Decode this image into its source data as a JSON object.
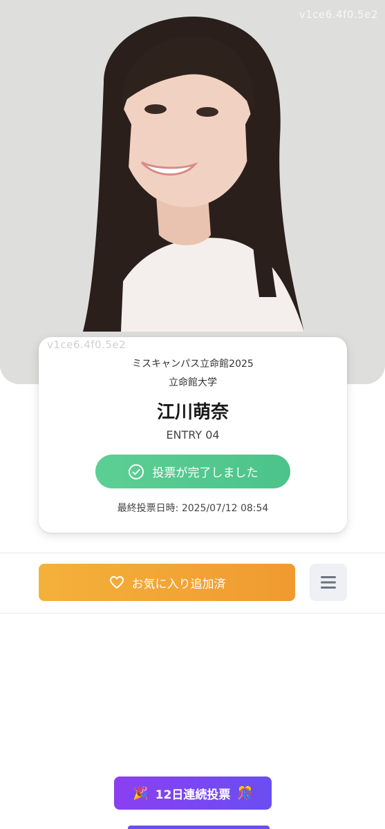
{
  "hero": {
    "watermark": "v1ce6.4f0.5e2",
    "photo_alt": "portrait photo"
  },
  "card": {
    "watermark": "v1ce6.4f0.5e2",
    "contest": "ミスキャンパス立命館2025",
    "university": "立命館大学",
    "name": "江川萌奈",
    "entry": "ENTRY 04",
    "vote_status": "投票が完了しました",
    "last_vote": "最終投票日時: 2025/07/12 08:54"
  },
  "actions": {
    "favorite_label": "お気に入り追加済"
  },
  "streak": {
    "label": "12日連続投票",
    "emoji_left": "🎉",
    "emoji_right": "🎊"
  },
  "colors": {
    "vote_green": "#4cc38a",
    "favorite_orange": "#f09a30",
    "streak_purple": "#7a45f1"
  }
}
